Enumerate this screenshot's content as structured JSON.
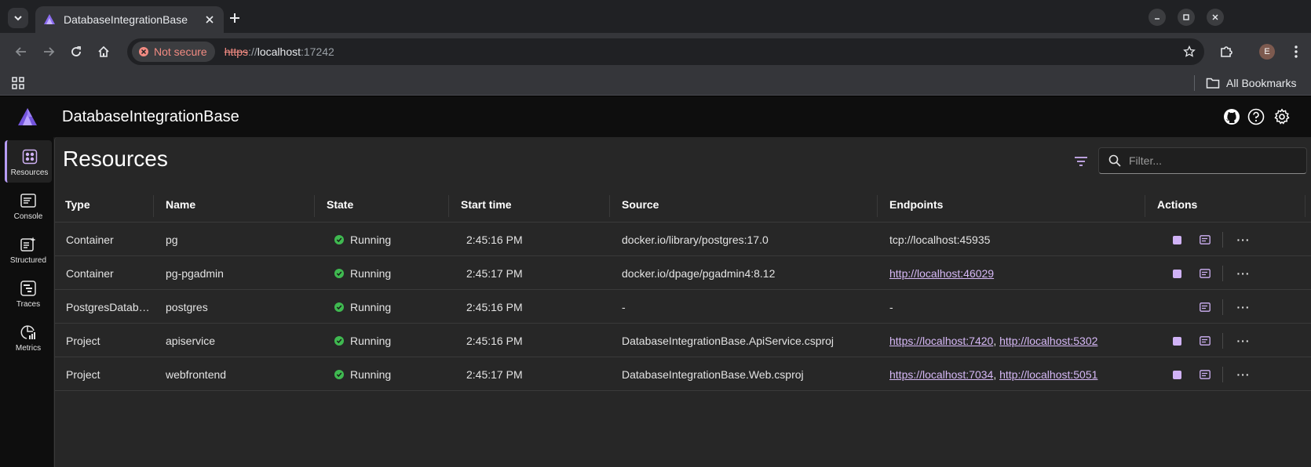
{
  "browser": {
    "tab_title": "DatabaseIntegrationBase",
    "security_chip": "Not secure",
    "url_scheme": "https",
    "url_sep": "://",
    "url_host": "localhost",
    "url_port": ":17242",
    "avatar_letter": "E",
    "all_bookmarks": "All Bookmarks"
  },
  "app": {
    "title": "DatabaseIntegrationBase",
    "nav": [
      {
        "label": "Resources",
        "icon": "resources-icon",
        "active": true
      },
      {
        "label": "Console",
        "icon": "console-icon"
      },
      {
        "label": "Structured",
        "icon": "structured-logs-icon"
      },
      {
        "label": "Traces",
        "icon": "traces-icon"
      },
      {
        "label": "Metrics",
        "icon": "metrics-icon"
      }
    ]
  },
  "resources": {
    "page_title": "Resources",
    "filter_placeholder": "Filter...",
    "columns": [
      "Type",
      "Name",
      "State",
      "Start time",
      "Source",
      "Endpoints",
      "Actions"
    ],
    "rows": [
      {
        "type": "Container",
        "name": "pg",
        "state": "Running",
        "start": "2:45:16 PM",
        "source": "docker.io/library/postgres:17.0",
        "endpoints": [
          {
            "text": "tcp://localhost:45935",
            "link": false
          }
        ],
        "stop": true
      },
      {
        "type": "Container",
        "name": "pg-pgadmin",
        "state": "Running",
        "start": "2:45:17 PM",
        "source": "docker.io/dpage/pgadmin4:8.12",
        "endpoints": [
          {
            "text": "http://localhost:46029",
            "link": true
          }
        ],
        "stop": true
      },
      {
        "type": "PostgresDatab…",
        "name": "postgres",
        "state": "Running",
        "start": "2:45:16 PM",
        "source": "-",
        "endpoints": [
          {
            "text": "-",
            "link": false
          }
        ],
        "stop": false
      },
      {
        "type": "Project",
        "name": "apiservice",
        "state": "Running",
        "start": "2:45:16 PM",
        "source": "DatabaseIntegrationBase.ApiService.csproj",
        "endpoints": [
          {
            "text": "https://localhost:7420",
            "link": true
          },
          {
            "text": "http://localhost:5302",
            "link": true
          }
        ],
        "stop": true
      },
      {
        "type": "Project",
        "name": "webfrontend",
        "state": "Running",
        "start": "2:45:17 PM",
        "source": "DatabaseIntegrationBase.Web.csproj",
        "endpoints": [
          {
            "text": "https://localhost:7034",
            "link": true
          },
          {
            "text": "http://localhost:5051",
            "link": true
          }
        ],
        "stop": true
      }
    ],
    "more_glyph": "···"
  },
  "colors": {
    "accent": "#d0b2f6",
    "running": "#3fb950",
    "insecure": "#f28b82"
  }
}
